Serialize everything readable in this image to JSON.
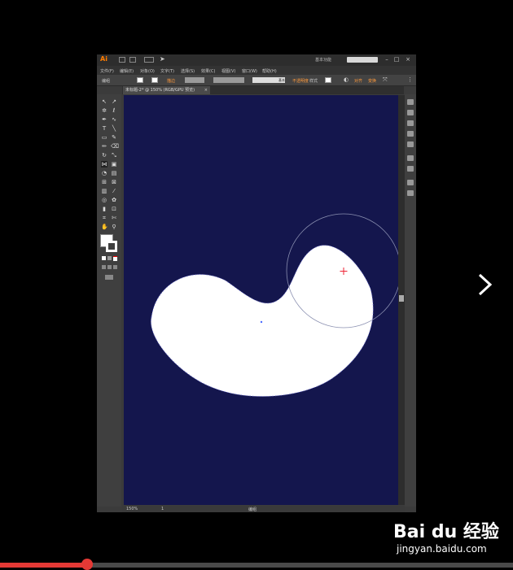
{
  "app": {
    "logo": "Ai",
    "workspace": "基本功能",
    "window_buttons": [
      "–",
      "□",
      "×"
    ]
  },
  "menu": [
    "文件(F)",
    "编辑(E)",
    "对象(O)",
    "文字(T)",
    "选择(S)",
    "效果(C)",
    "视图(V)",
    "窗口(W)",
    "帮助(H)"
  ],
  "control_bar": {
    "selection": "编组",
    "stroke_label": "描边",
    "stroke_style": "基本",
    "opacity_label": "不透明度",
    "style_label": "样式",
    "align_label": "对齐",
    "transform_label": "变换"
  },
  "document_tab": {
    "title": "未标题-2* @ 150% (RGB/GPU 预览)",
    "close": "×"
  },
  "status_bar": {
    "zoom": "150%",
    "page": "1",
    "tool": "编组"
  },
  "colors": {
    "canvas_bg": "#14164d",
    "shape_fill": "#ffffff",
    "accent": "#ff7c00",
    "progress": "#e53935"
  },
  "icons": {
    "next": "chevron-right-icon"
  },
  "player": {
    "progress": 0.17
  },
  "watermark": {
    "brand": "Bai du 经验",
    "url": "jingyan.baidu.com"
  }
}
